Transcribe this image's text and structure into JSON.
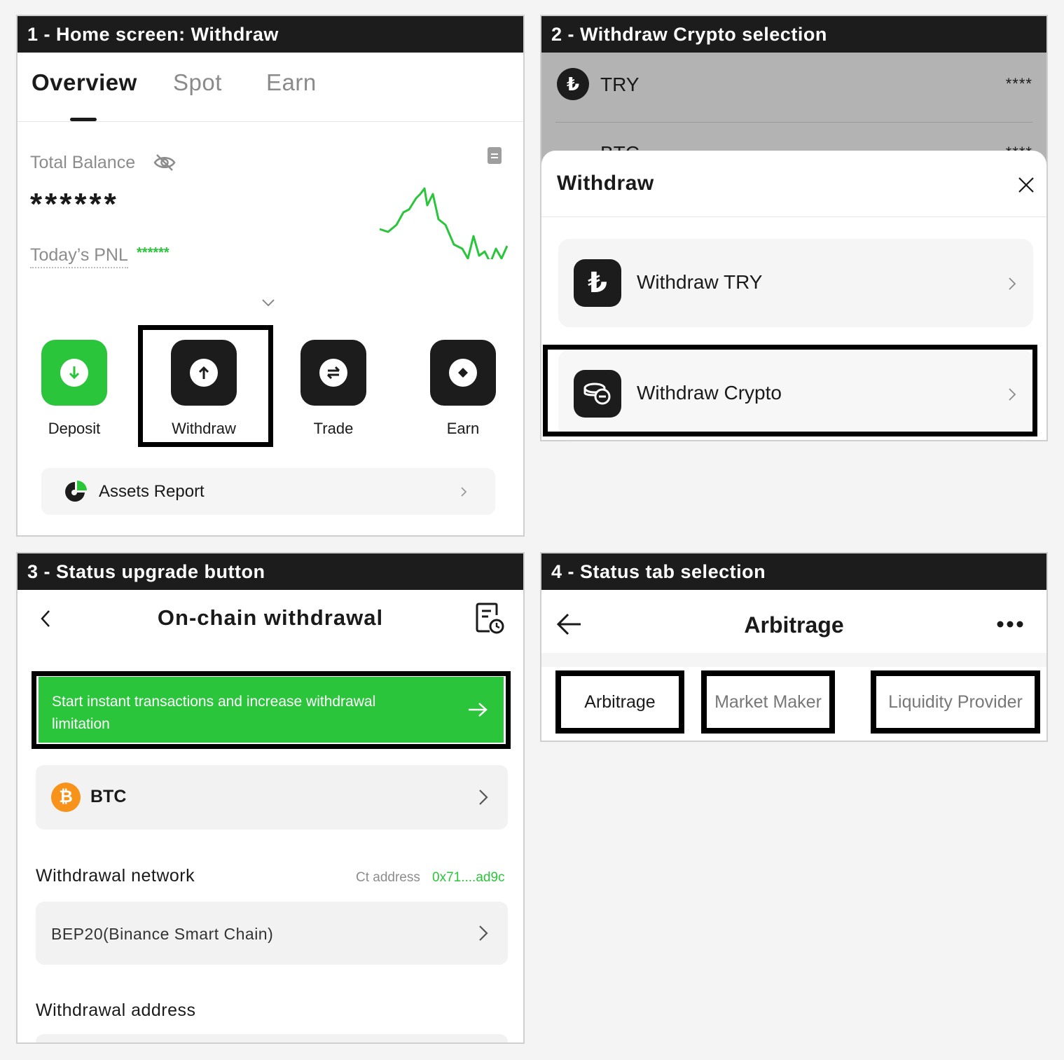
{
  "panel1": {
    "header": "1 - Home screen: Withdraw",
    "tabs": [
      "Overview",
      "Spot",
      "Earn"
    ],
    "total_balance_label": "Total Balance",
    "balance_masked": "******",
    "pnl_label": "Today’s PNL",
    "pnl_value": "******",
    "actions": [
      "Deposit",
      "Withdraw",
      "Trade",
      "Earn"
    ],
    "assets_report": "Assets Report",
    "colors": {
      "accent": "#2ac53a",
      "dark": "#1c1c1c"
    }
  },
  "panel2": {
    "header": "2 - Withdraw Crypto selection",
    "bg_rows": [
      {
        "symbol": "TRY",
        "value": "****"
      },
      {
        "symbol": "BTC",
        "value": "****"
      }
    ],
    "sheet_title": "Withdraw",
    "options": [
      "Withdraw TRY",
      "Withdraw Crypto"
    ],
    "lira_glyph": "₺"
  },
  "panel3": {
    "header": "3 - Status upgrade button",
    "title": "On-chain withdrawal",
    "banner_line1": "Start instant transactions and increase withdrawal",
    "banner_line2": "limitation",
    "coin": "BTC",
    "coin_glyph": "₿",
    "network_label": "Withdrawal network",
    "ct_address_label": "Ct address",
    "ct_address_value": "0x71....ad9c",
    "network_value": "BEP20(Binance Smart Chain)",
    "address_label": "Withdrawal address"
  },
  "panel4": {
    "header": "4 - Status tab selection",
    "title": "Arbitrage",
    "tabs": [
      "Arbitrage",
      "Market Maker",
      "Liquidity Provider"
    ]
  }
}
